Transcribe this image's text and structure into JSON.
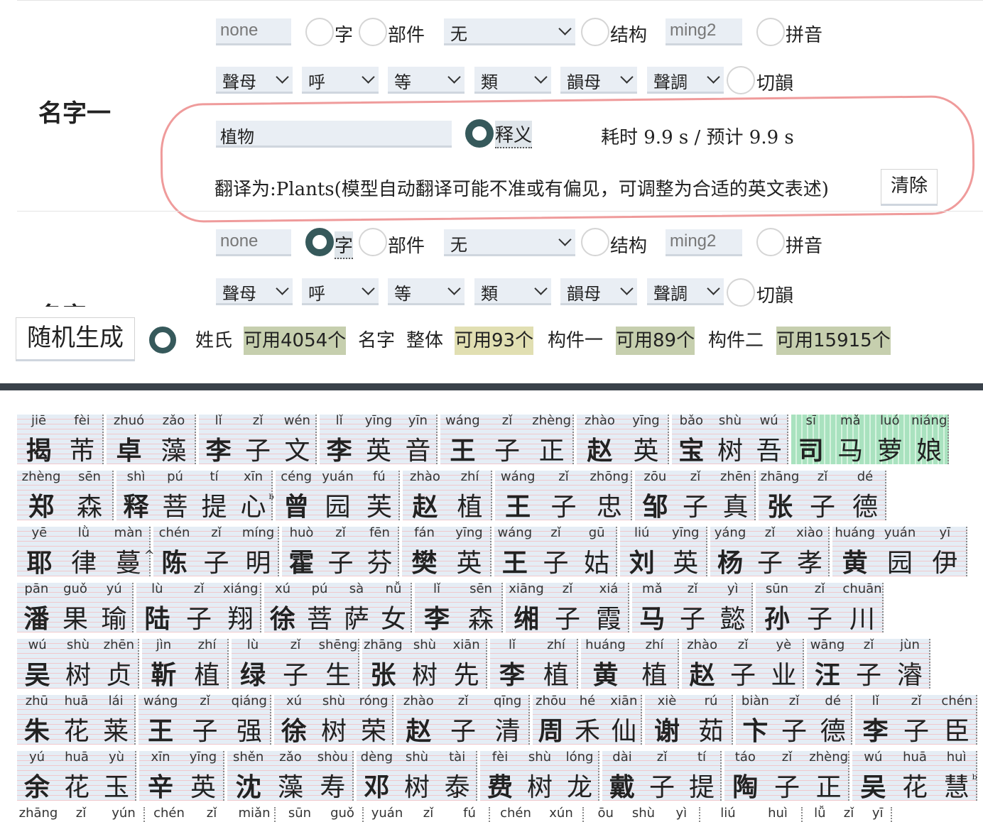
{
  "row1": {
    "label": "名字一",
    "char_input": {
      "placeholder": "none"
    },
    "radio_zi": "字",
    "radio_bujian": "部件",
    "bujian_select": "无",
    "radio_jiegou": "结构",
    "pinyin_input": {
      "placeholder": "ming2"
    },
    "radio_pinyin": "拼音",
    "selects": [
      "聲母",
      "呼",
      "等",
      "類",
      "韻母",
      "聲調"
    ],
    "radio_qieyun": "切韻",
    "meaning_input": "植物",
    "radio_shiyi": "释义",
    "timing": "耗时 9.9 s / 预计 9.9 s",
    "translation": "翻译为:Plants(模型自动翻译可能不准或有偏见，可调整为合适的英文表述)",
    "clear_button": "清除"
  },
  "row2": {
    "label": "名字二",
    "char_input": {
      "placeholder": "none"
    },
    "radio_zi": "字",
    "radio_bujian": "部件",
    "bujian_select": "无",
    "radio_jiegou": "结构",
    "pinyin_input": {
      "placeholder": "ming2"
    },
    "radio_pinyin": "拼音",
    "selects": [
      "聲母",
      "呼",
      "等",
      "類",
      "韻母",
      "聲調"
    ],
    "radio_qieyun": "切韻"
  },
  "generate": {
    "button": "随机生成",
    "surname_label": "姓氏",
    "surname_count": "可用4054个",
    "name_label": "名字",
    "whole_label": "整体",
    "whole_count": "可用93个",
    "part1_label": "构件一",
    "part1_count": "可用89个",
    "part2_label": "构件二",
    "part2_count": "可用15915个"
  },
  "names": [
    [
      {
        "py": [
          "jiē",
          "fèi"
        ],
        "cn": [
          "揭",
          "芾"
        ]
      },
      {
        "py": [
          "zhuó",
          "zǎo"
        ],
        "cn": [
          "卓",
          "藻"
        ]
      },
      {
        "py": [
          "lǐ",
          "zǐ",
          "wén"
        ],
        "cn": [
          "李",
          "子",
          "文"
        ]
      },
      {
        "py": [
          "lǐ",
          "yīng",
          "yīn"
        ],
        "cn": [
          "李",
          "英",
          "音"
        ]
      },
      {
        "py": [
          "wáng",
          "zǐ",
          "zhèng"
        ],
        "cn": [
          "王",
          "子",
          "正"
        ]
      },
      {
        "py": [
          "zhào",
          "yīng"
        ],
        "cn": [
          "赵",
          "英"
        ]
      },
      {
        "py": [
          "bǎo",
          "shù",
          "wú"
        ],
        "cn": [
          "宝",
          "树",
          "吾"
        ]
      },
      {
        "py": [
          "sī",
          "mǎ",
          "luó",
          "niáng"
        ],
        "cn": [
          "司",
          "马",
          "萝",
          "娘"
        ],
        "style": "green"
      }
    ],
    [
      {
        "py": [
          "zhèng",
          "sēn"
        ],
        "cn": [
          "郑",
          "森"
        ]
      },
      {
        "py": [
          "shì",
          "pú",
          "tí",
          "xīn"
        ],
        "cn": [
          "释",
          "菩",
          "提",
          "心"
        ],
        "mark": "ᵇ"
      },
      {
        "py": [
          "céng",
          "yuán",
          "fú"
        ],
        "cn": [
          "曾",
          "园",
          "芙"
        ]
      },
      {
        "py": [
          "zhào",
          "zhí"
        ],
        "cn": [
          "赵",
          "植"
        ]
      },
      {
        "py": [
          "wáng",
          "zǐ",
          "zhōng"
        ],
        "cn": [
          "王",
          "子",
          "忠"
        ]
      },
      {
        "py": [
          "zōu",
          "zǐ",
          "zhēn"
        ],
        "cn": [
          "邹",
          "子",
          "真"
        ]
      },
      {
        "py": [
          "zhāng",
          "zǐ",
          "dé"
        ],
        "cn": [
          "张",
          "子",
          "德"
        ]
      }
    ],
    [
      {
        "py": [
          "yē",
          "lǜ",
          "màn"
        ],
        "cn": [
          "耶",
          "律",
          "蔓"
        ],
        "mark": "^"
      },
      {
        "py": [
          "chén",
          "zǐ",
          "míng"
        ],
        "cn": [
          "陈",
          "子",
          "明"
        ]
      },
      {
        "py": [
          "huò",
          "zǐ",
          "fēn"
        ],
        "cn": [
          "霍",
          "子",
          "芬"
        ]
      },
      {
        "py": [
          "fán",
          "yīng"
        ],
        "cn": [
          "樊",
          "英"
        ]
      },
      {
        "py": [
          "wáng",
          "zǐ",
          "gū"
        ],
        "cn": [
          "王",
          "子",
          "姑"
        ]
      },
      {
        "py": [
          "liú",
          "yīng"
        ],
        "cn": [
          "刘",
          "英"
        ]
      },
      {
        "py": [
          "yáng",
          "zǐ",
          "xiào"
        ],
        "cn": [
          "杨",
          "子",
          "孝"
        ]
      },
      {
        "py": [
          "huáng",
          "yuán",
          "yī"
        ],
        "cn": [
          "黄",
          "园",
          "伊"
        ]
      }
    ],
    [
      {
        "py": [
          "pān",
          "guǒ",
          "yú"
        ],
        "cn": [
          "潘",
          "果",
          "瑜"
        ]
      },
      {
        "py": [
          "lù",
          "zǐ",
          "xiáng"
        ],
        "cn": [
          "陆",
          "子",
          "翔"
        ]
      },
      {
        "py": [
          "xú",
          "pú",
          "sà",
          "nǚ"
        ],
        "cn": [
          "徐",
          "菩",
          "萨",
          "女"
        ]
      },
      {
        "py": [
          "lǐ",
          "sēn"
        ],
        "cn": [
          "李",
          "森"
        ]
      },
      {
        "py": [
          "xiāng",
          "zǐ",
          "xiá"
        ],
        "cn": [
          "缃",
          "子",
          "霞"
        ]
      },
      {
        "py": [
          "mǎ",
          "zǐ",
          "yì"
        ],
        "cn": [
          "马",
          "子",
          "懿"
        ]
      },
      {
        "py": [
          "sūn",
          "zǐ",
          "chuān"
        ],
        "cn": [
          "孙",
          "子",
          "川"
        ]
      }
    ],
    [
      {
        "py": [
          "wú",
          "shù",
          "zhēn"
        ],
        "cn": [
          "吴",
          "树",
          "贞"
        ]
      },
      {
        "py": [
          "jìn",
          "zhí"
        ],
        "cn": [
          "靳",
          "植"
        ]
      },
      {
        "py": [
          "lù",
          "zǐ",
          "shēng"
        ],
        "cn": [
          "绿",
          "子",
          "生"
        ]
      },
      {
        "py": [
          "zhāng",
          "shù",
          "xiān"
        ],
        "cn": [
          "张",
          "树",
          "先"
        ]
      },
      {
        "py": [
          "lǐ",
          "zhí"
        ],
        "cn": [
          "李",
          "植"
        ]
      },
      {
        "py": [
          "huáng",
          "zhí"
        ],
        "cn": [
          "黄",
          "植"
        ]
      },
      {
        "py": [
          "zhào",
          "zǐ",
          "yè"
        ],
        "cn": [
          "赵",
          "子",
          "业"
        ]
      },
      {
        "py": [
          "wāng",
          "zǐ",
          "jùn"
        ],
        "cn": [
          "汪",
          "子",
          "濬"
        ]
      }
    ],
    [
      {
        "py": [
          "zhū",
          "huā",
          "lái"
        ],
        "cn": [
          "朱",
          "花",
          "莱"
        ]
      },
      {
        "py": [
          "wáng",
          "zǐ",
          "qiáng"
        ],
        "cn": [
          "王",
          "子",
          "强"
        ]
      },
      {
        "py": [
          "xú",
          "shù",
          "róng"
        ],
        "cn": [
          "徐",
          "树",
          "荣"
        ]
      },
      {
        "py": [
          "zhào",
          "zǐ",
          "qīng"
        ],
        "cn": [
          "赵",
          "子",
          "清"
        ]
      },
      {
        "py": [
          "zhōu",
          "hé",
          "xiān"
        ],
        "cn": [
          "周",
          "禾",
          "仙"
        ]
      },
      {
        "py": [
          "xiè",
          "rú"
        ],
        "cn": [
          "谢",
          "茹"
        ]
      },
      {
        "py": [
          "biàn",
          "zǐ",
          "dé"
        ],
        "cn": [
          "卞",
          "子",
          "德"
        ]
      },
      {
        "py": [
          "lǐ",
          "zǐ",
          "chén"
        ],
        "cn": [
          "李",
          "子",
          "臣"
        ]
      }
    ],
    [
      {
        "py": [
          "yú",
          "huā",
          "yù"
        ],
        "cn": [
          "余",
          "花",
          "玉"
        ]
      },
      {
        "py": [
          "xīn",
          "yīng"
        ],
        "cn": [
          "辛",
          "英"
        ]
      },
      {
        "py": [
          "shěn",
          "zǎo",
          "shòu"
        ],
        "cn": [
          "沈",
          "藻",
          "寿"
        ]
      },
      {
        "py": [
          "dèng",
          "shù",
          "tài"
        ],
        "cn": [
          "邓",
          "树",
          "泰"
        ]
      },
      {
        "py": [
          "fèi",
          "shù",
          "lóng"
        ],
        "cn": [
          "费",
          "树",
          "龙"
        ]
      },
      {
        "py": [
          "dài",
          "zǐ",
          "tí"
        ],
        "cn": [
          "戴",
          "子",
          "提"
        ]
      },
      {
        "py": [
          "táo",
          "zǐ",
          "zhèng"
        ],
        "cn": [
          "陶",
          "子",
          "正"
        ]
      },
      {
        "py": [
          "wú",
          "huā",
          "huì"
        ],
        "cn": [
          "吴",
          "花",
          "慧"
        ],
        "mark": "ᵇ"
      }
    ],
    [
      {
        "py": [
          "zhāng",
          "zǐ",
          "yún"
        ],
        "cn": []
      },
      {
        "py": [
          "chén",
          "zǐ",
          "miǎn"
        ],
        "cn": []
      },
      {
        "py": [
          "sūn",
          "guǒ"
        ],
        "cn": []
      },
      {
        "py": [
          "yuán",
          "zǐ",
          "fú"
        ],
        "cn": []
      },
      {
        "py": [
          "chén",
          "xún"
        ],
        "cn": []
      },
      {
        "py": [
          "ōu",
          "shù",
          "yì"
        ],
        "cn": []
      },
      {
        "py": [
          "liú",
          "huì"
        ],
        "cn": []
      },
      {
        "py": [
          "lǚ",
          "zǐ",
          "yī"
        ],
        "cn": []
      }
    ]
  ]
}
